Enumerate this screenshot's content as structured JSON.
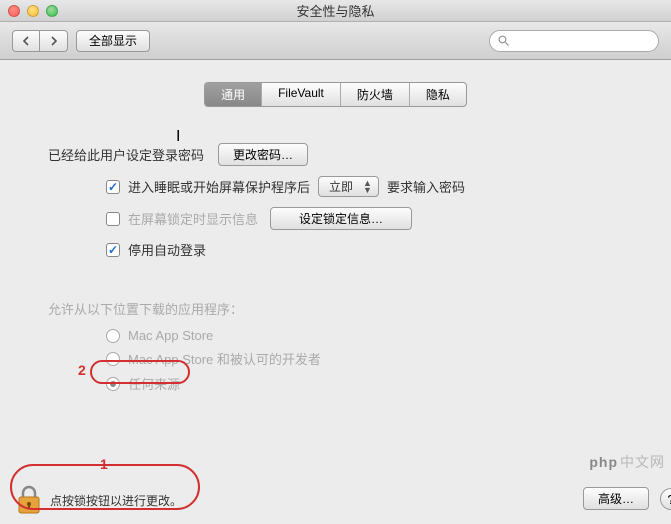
{
  "window": {
    "title": "安全性与隐私"
  },
  "toolbar": {
    "show_all": "全部显示",
    "search_placeholder": ""
  },
  "tabs": [
    {
      "label": "通用",
      "active": true
    },
    {
      "label": "FileVault",
      "active": false
    },
    {
      "label": "防火墙",
      "active": false
    },
    {
      "label": "隐私",
      "active": false
    }
  ],
  "login": {
    "label": "已经给此用户设定登录密码",
    "change_password_btn": "更改密码…"
  },
  "sleep": {
    "checkbox_label": "进入睡眠或开始屏幕保护程序后",
    "select_value": "立即",
    "suffix": "要求输入密码"
  },
  "lockmsg": {
    "checkbox_label": "在屏幕锁定时显示信息",
    "set_btn": "设定锁定信息…"
  },
  "autologin": {
    "checkbox_label": "停用自动登录"
  },
  "allow_apps": {
    "heading": "允许从以下位置下载的应用程序：",
    "options": [
      "Mac App Store",
      "Mac App Store 和被认可的开发者",
      "任何来源"
    ],
    "selected_index": 2
  },
  "footer": {
    "lock_text": "点按锁按钮以进行更改。",
    "advanced_btn": "高级…"
  },
  "annotations": {
    "num1": "1",
    "num2": "2"
  },
  "watermark": {
    "brand": "php",
    "text": "中文网"
  }
}
